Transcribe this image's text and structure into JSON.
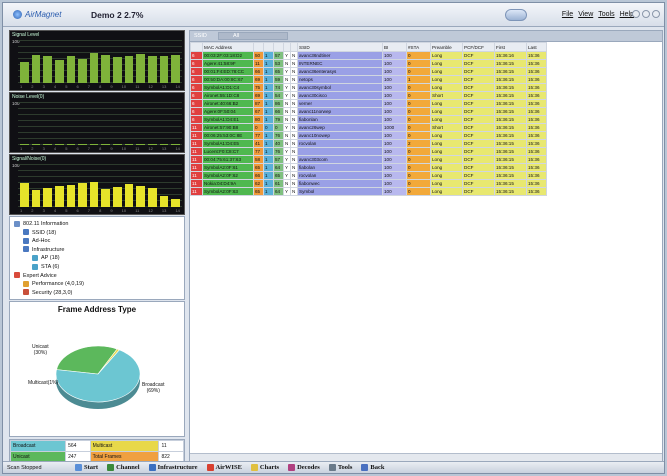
{
  "title": {
    "app": "AirMagnet",
    "session": "Demo 2 2.7%"
  },
  "menu": [
    "File",
    "View",
    "Tools",
    "Help"
  ],
  "panels": {
    "signal_level": {
      "label": "Signal Level",
      "color": "#7fb33a",
      "values": [
        0.55,
        0.75,
        0.72,
        0.6,
        0.7,
        0.62,
        0.78,
        0.74,
        0.68,
        0.72,
        0.76,
        0.7,
        0.7,
        0.74
      ],
      "ticks": [
        "1",
        "2",
        "3",
        "4",
        "5",
        "6",
        "7",
        "8",
        "9",
        "10",
        "11",
        "12",
        "13",
        "14"
      ],
      "ymax": "100"
    },
    "noise_level": {
      "label": "Noise Level(0)",
      "color": "#7fb33a",
      "values": [
        0.02,
        0.02,
        0.02,
        0.02,
        0.02,
        0.02,
        0.02,
        0.02,
        0.02,
        0.02,
        0.02,
        0.02,
        0.02,
        0.02
      ],
      "ticks": [
        "1",
        "2",
        "3",
        "4",
        "5",
        "6",
        "7",
        "8",
        "9",
        "10",
        "11",
        "12",
        "13",
        "14"
      ],
      "ymax": "100"
    },
    "signal_noise": {
      "label": "Signal/Noise(0)",
      "color": "#e6e32a",
      "values": [
        0.62,
        0.45,
        0.5,
        0.55,
        0.58,
        0.62,
        0.65,
        0.48,
        0.52,
        0.6,
        0.55,
        0.5,
        0.3,
        0.2
      ],
      "ticks": [
        "1",
        "2",
        "3",
        "4",
        "5",
        "6",
        "7",
        "8",
        "9",
        "10",
        "11",
        "12",
        "13",
        "14"
      ],
      "ymax": "100"
    }
  },
  "tree": [
    {
      "label": "802.11 Information",
      "indent": 0,
      "color": "#6b8fc7"
    },
    {
      "label": "SSID (18)",
      "indent": 1,
      "color": "#4a78c0"
    },
    {
      "label": "Ad-Hoc",
      "indent": 1,
      "color": "#4a78c0"
    },
    {
      "label": "Infrastructure",
      "indent": 1,
      "color": "#4a78c0"
    },
    {
      "label": "AP (18)",
      "indent": 2,
      "color": "#4aa2c8"
    },
    {
      "label": "STA (6)",
      "indent": 2,
      "color": "#4aa2c8"
    },
    {
      "label": "Expert Advice",
      "indent": 0,
      "color": "#d94b3b"
    },
    {
      "label": "Performance (4,0,19)",
      "indent": 1,
      "color": "#e0a030"
    },
    {
      "label": "Security (28,3,0)",
      "indent": 1,
      "color": "#c8503a"
    }
  ],
  "pie": {
    "title": "Frame Address Type",
    "slices": [
      {
        "label": "Unicast",
        "pct": "(30%)",
        "value": 30,
        "color": "#5cb85c"
      },
      {
        "label": "Multicast(1%)",
        "pct": "",
        "value": 1,
        "color": "#e8d84a"
      },
      {
        "label": "Broadcast",
        "pct": "(69%)",
        "value": 69,
        "color": "#6cc6d2"
      }
    ]
  },
  "stats": [
    [
      {
        "label": "Broadcast",
        "color": "#6cc6d2"
      },
      {
        "label": "564",
        "color": "#fff"
      },
      {
        "label": "Multicast",
        "color": "#e8d84a"
      },
      {
        "label": "11",
        "color": "#fff"
      }
    ],
    [
      {
        "label": "Unicast",
        "color": "#5cb85c"
      },
      {
        "label": "247",
        "color": "#fff"
      },
      {
        "label": "Total Frames",
        "color": "#f0a040"
      },
      {
        "label": "822",
        "color": "#fff"
      }
    ]
  ],
  "filter": {
    "label": "SSID",
    "value": "All"
  },
  "table": {
    "columns": [
      "",
      "MAC Address",
      "",
      "",
      "",
      "",
      "",
      "SSID",
      "BI",
      "#STA",
      "Preamble",
      "PCF/DCF",
      "First",
      "Last"
    ],
    "col_colors": [
      "#e04040",
      "#4fb84f",
      "#f09a3a",
      "#5ab0d8",
      "#7fc07f",
      "#ffffff",
      "#ffffff",
      "#9aa0e6",
      "#b8b8ee",
      "#f2a93a",
      "#e8e870",
      "#e8e870",
      "#e8e870",
      "#e8e870"
    ],
    "rows": [
      [
        "6",
        "00:03:2F:03:18:D2",
        "50",
        "1",
        "57",
        "Y",
        "N",
        "avanc36ndtiner",
        "100",
        "0",
        "Long",
        "DCF",
        "15:36:16",
        "15:36"
      ],
      [
        "6",
        "Agere:41:58:9F",
        "11",
        "1",
        "53",
        "N",
        "N",
        "INTERNEC",
        "100",
        "0",
        "Long",
        "DCF",
        "15:36:15",
        "15:36"
      ],
      [
        "6",
        "00:01:F4:ED:78:CC",
        "66",
        "1",
        "65",
        "Y",
        "N",
        "avanc36enterasys",
        "100",
        "0",
        "Long",
        "DCF",
        "15:36:15",
        "15:36"
      ],
      [
        "6",
        "00:50:DA:00:8C:67",
        "69",
        "1",
        "59",
        "N",
        "N",
        "netops",
        "100",
        "1",
        "Long",
        "DCF",
        "15:36:15",
        "15:36"
      ],
      [
        "6",
        "SymbolA1:D1:C4",
        "75",
        "1",
        "74",
        "Y",
        "N",
        "avanc30symbol",
        "100",
        "0",
        "Long",
        "DCF",
        "15:36:15",
        "15:36"
      ],
      [
        "6",
        "Aironet:55:1D:C8",
        "69",
        "1",
        "54",
        "Y",
        "N",
        "avanc30cisco",
        "100",
        "0",
        "Short",
        "DCF",
        "15:36:15",
        "15:36"
      ],
      [
        "6",
        "Aironet:40:66:B2",
        "87",
        "1",
        "86",
        "N",
        "N",
        "verner",
        "100",
        "0",
        "Long",
        "DCF",
        "15:36:15",
        "15:36"
      ],
      [
        "6",
        "Agere:0F:50:04",
        "67",
        "1",
        "66",
        "N",
        "N",
        "avanc11norwep",
        "100",
        "0",
        "Long",
        "DCF",
        "15:36:15",
        "15:36"
      ],
      [
        "6",
        "SymbolA1:D4:E1",
        "80",
        "1",
        "79",
        "N",
        "N",
        "fiabonlan",
        "100",
        "0",
        "Long",
        "DCF",
        "15:36:15",
        "15:36"
      ],
      [
        "11",
        "Aironet:57:90:B8",
        "0",
        "0",
        "0",
        "Y",
        "N",
        "avanc26wep",
        "1000",
        "0",
        "Short",
        "DCF",
        "15:36:15",
        "15:36"
      ],
      [
        "11",
        "00:06:25:53:0C:8E",
        "77",
        "1",
        "76",
        "N",
        "N",
        "avanc10nowep",
        "100",
        "0",
        "Long",
        "DCF",
        "15:36:15",
        "15:36"
      ],
      [
        "11",
        "SymbolA1:D4:E5",
        "41",
        "1",
        "40",
        "N",
        "N",
        "rocvolan",
        "100",
        "2",
        "Long",
        "DCF",
        "15:36:15",
        "15:36"
      ],
      [
        "11",
        "Lucent:F0:C8:C7",
        "77",
        "1",
        "76",
        "Y",
        "N",
        "",
        "100",
        "0",
        "Long",
        "DCF",
        "15:36:15",
        "15:36"
      ],
      [
        "11",
        "00:04:75:61:37:63",
        "58",
        "1",
        "57",
        "Y",
        "N",
        "avanc303com",
        "100",
        "0",
        "Long",
        "DCF",
        "15:36:15",
        "15:36"
      ],
      [
        "11",
        "SymbolA2:0F:61",
        "65",
        "1",
        "64",
        "Y",
        "N",
        "fiabolan",
        "100",
        "0",
        "Long",
        "DCF",
        "15:36:15",
        "15:36"
      ],
      [
        "11",
        "SymbolA2:0F:62",
        "66",
        "1",
        "65",
        "Y",
        "N",
        "rocvolan",
        "100",
        "0",
        "Long",
        "DCF",
        "15:36:15",
        "15:36"
      ],
      [
        "11",
        "Nokia:04:D4:9A",
        "62",
        "1",
        "61",
        "N",
        "N",
        "fiabonwec",
        "100",
        "0",
        "Long",
        "DCF",
        "15:36:15",
        "15:36"
      ],
      [
        "11",
        "SymbolA2:0F:63",
        "65",
        "1",
        "64",
        "Y",
        "N",
        "Symbol",
        "100",
        "0",
        "Long",
        "DCF",
        "15:36:15",
        "15:36"
      ]
    ]
  },
  "status": "Scan Stopped",
  "toolbar": [
    {
      "label": "Start",
      "color": "#5a8fd8"
    },
    {
      "label": "Channel",
      "color": "#3a8a3a"
    },
    {
      "label": "Infrastructure",
      "color": "#3a6fc0"
    },
    {
      "label": "AirWISE",
      "color": "#d84030"
    },
    {
      "label": "Charts",
      "color": "#e0c040"
    },
    {
      "label": "Decodes",
      "color": "#b04080"
    },
    {
      "label": "Tools",
      "color": "#6a7a8a"
    },
    {
      "label": "Back",
      "color": "#4a70c0"
    }
  ]
}
